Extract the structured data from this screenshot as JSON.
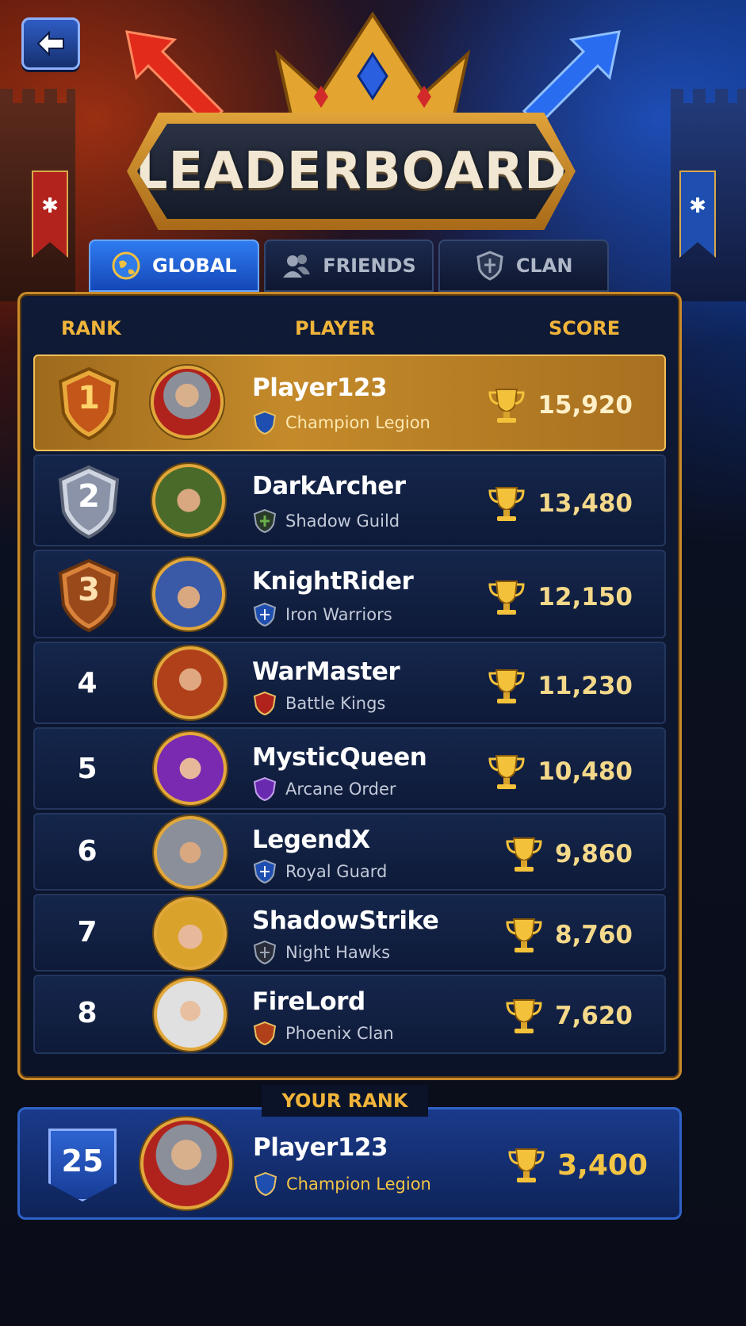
{
  "title": "LEADERBOARD",
  "tabs": [
    {
      "label": "GLOBAL",
      "icon": "globe-icon",
      "active": true
    },
    {
      "label": "FRIENDS",
      "icon": "friends-icon",
      "active": false
    },
    {
      "label": "CLAN",
      "icon": "shield-icon",
      "active": false
    }
  ],
  "columns": {
    "rank": "RANK",
    "player": "PLAYER",
    "score": "SCORE"
  },
  "rows": [
    {
      "rank": "1",
      "name": "Player123",
      "clan": "Champion Legion",
      "score": "15,920"
    },
    {
      "rank": "2",
      "name": "DarkArcher",
      "clan": "Shadow Guild",
      "score": "13,480"
    },
    {
      "rank": "3",
      "name": "KnightRider",
      "clan": "Iron Warriors",
      "score": "12,150"
    },
    {
      "rank": "4",
      "name": "WarMaster",
      "clan": "Battle Kings",
      "score": "11,230"
    },
    {
      "rank": "5",
      "name": "MysticQueen",
      "clan": "Arcane Order",
      "score": "10,480"
    },
    {
      "rank": "6",
      "name": "LegendX",
      "clan": "Royal Guard",
      "score": "9,860"
    },
    {
      "rank": "7",
      "name": "ShadowStrike",
      "clan": "Night Hawks",
      "score": "8,760"
    },
    {
      "rank": "8",
      "name": "FireLord",
      "clan": "Phoenix Clan",
      "score": "7,620"
    }
  ],
  "your_rank": {
    "label": "YOUR RANK",
    "rank": "25",
    "name": "Player123",
    "clan": "Champion Legion",
    "score": "3,400"
  },
  "colors": {
    "gold": "#f0b43a",
    "first_row": "#c48a2a",
    "active_tab": "#2f7bf0",
    "panel": "#0f1a36"
  }
}
